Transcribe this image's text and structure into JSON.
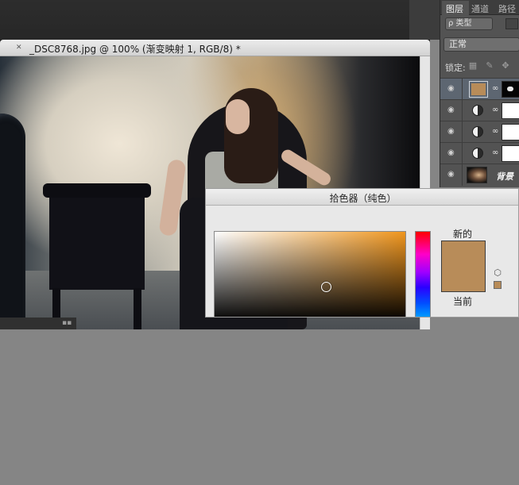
{
  "document": {
    "title": "_DSC8768.jpg @ 100% (渐变映射 1, RGB/8) *",
    "close_icon": "close-icon"
  },
  "layers_panel": {
    "tabs": [
      {
        "label": "图层",
        "active": true
      },
      {
        "label": "通道",
        "active": false
      },
      {
        "label": "路径",
        "active": false
      }
    ],
    "filter_label": "ρ 类型",
    "blend_mode": "正常",
    "lock_label": "锁定:",
    "lock_icons": [
      "lock-pixels-icon",
      "lock-paint-icon",
      "lock-move-icon"
    ],
    "layers": [
      {
        "type": "fill",
        "visible": true,
        "selected": true,
        "swatch_color": "#b88c59",
        "mask": "black"
      },
      {
        "type": "adjustment",
        "visible": true,
        "selected": false,
        "mask": "white"
      },
      {
        "type": "adjustment",
        "visible": true,
        "selected": false,
        "mask": "white"
      },
      {
        "type": "adjustment",
        "visible": true,
        "selected": false,
        "mask": "white"
      },
      {
        "type": "photo",
        "visible": true,
        "selected": false,
        "name": "背景"
      }
    ]
  },
  "color_picker": {
    "title": "拾色器（纯色）",
    "new_label": "新的",
    "current_label": "当前",
    "new_color": "#b88c59",
    "current_color": "#b88c59",
    "field_base_hue": "#f0961e"
  }
}
